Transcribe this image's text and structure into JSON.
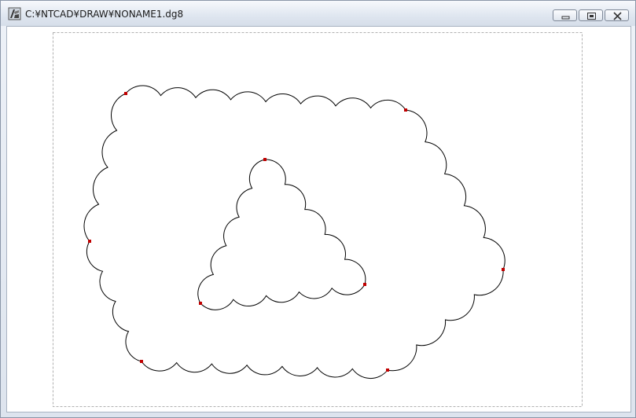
{
  "window": {
    "title": "C:¥NTCAD¥DRAW¥NONAME1.dg8"
  },
  "title_buttons": {
    "minimize_icon": "minimize-icon",
    "restore_icon": "restore-icon",
    "close_icon": "close-icon"
  },
  "drawing": {
    "stroke_color": "#000000",
    "handle_color": "#c00000",
    "page_border_color": "#b0b0b0",
    "shapes": [
      "outer-revision-cloud",
      "inner-revision-cloud"
    ]
  }
}
